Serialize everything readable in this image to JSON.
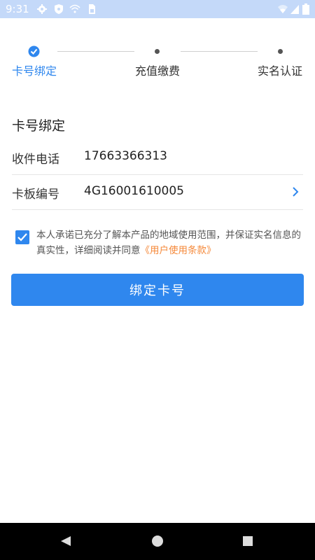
{
  "status_bar": {
    "time": "9:31",
    "icons": [
      "gear-icon",
      "shield-icon",
      "wifi-off-icon",
      "sim-icon",
      "wifi-icon",
      "signal-icon",
      "battery-icon"
    ],
    "background": "#c4d9f9"
  },
  "steps": [
    {
      "label": "卡号绑定",
      "state": "done"
    },
    {
      "label": "充值缴费",
      "state": "pending"
    },
    {
      "label": "实名认证",
      "state": "pending"
    }
  ],
  "form": {
    "title": "卡号绑定",
    "phone": {
      "label": "收件电话",
      "value": "17663366313"
    },
    "board": {
      "label": "卡板编号",
      "value": "4G16001610005"
    }
  },
  "agreement": {
    "checked": true,
    "text": "本人承诺已充分了解本产品的地域使用范围，并保证实名信息的真实性，详细阅读并同意",
    "link": "《用户使用条款》"
  },
  "bind_button": {
    "label": "绑定卡号"
  },
  "nav_bar": {
    "icons": [
      "back-icon",
      "home-icon",
      "recents-icon"
    ]
  },
  "colors": {
    "primary": "#2f87ee",
    "link": "#f5893a",
    "text": "#333333"
  }
}
